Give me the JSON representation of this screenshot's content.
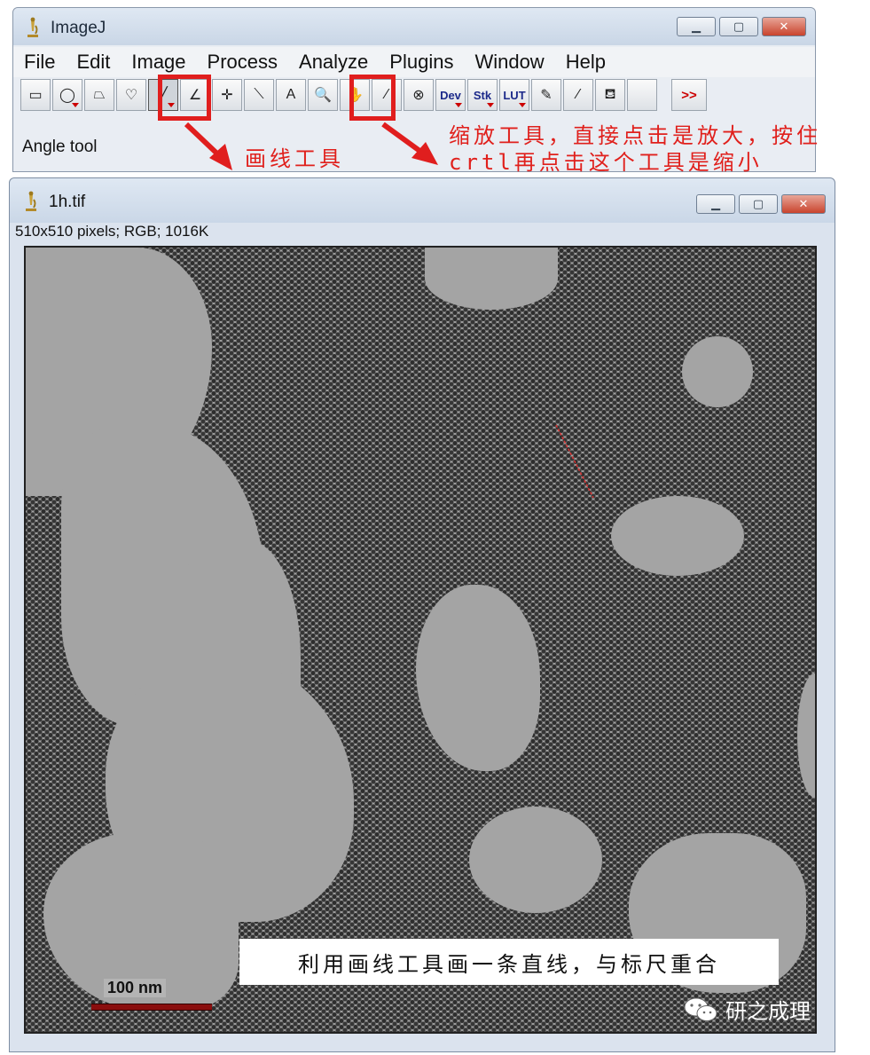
{
  "main_window": {
    "title": "ImageJ",
    "menu": [
      "File",
      "Edit",
      "Image",
      "Process",
      "Analyze",
      "Plugins",
      "Window",
      "Help"
    ],
    "tools": [
      {
        "name": "rectangle-tool",
        "icon": "rectangle-icon",
        "glyph": "▭",
        "selected": false
      },
      {
        "name": "oval-tool",
        "icon": "oval-icon",
        "glyph": "◯",
        "selected": false
      },
      {
        "name": "polygon-tool",
        "icon": "polygon-icon",
        "glyph": "⏢",
        "selected": false
      },
      {
        "name": "freehand-tool",
        "icon": "freehand-icon",
        "glyph": "♡",
        "selected": false
      },
      {
        "name": "line-tool",
        "icon": "line-icon",
        "glyph": "╱",
        "selected": true
      },
      {
        "name": "angle-tool",
        "icon": "angle-icon",
        "glyph": "∠",
        "selected": false
      },
      {
        "name": "point-tool",
        "icon": "point-icon",
        "glyph": "✛",
        "selected": false
      },
      {
        "name": "wand-tool",
        "icon": "wand-icon",
        "glyph": "⟍",
        "selected": false
      },
      {
        "name": "text-tool",
        "icon": "text-icon",
        "glyph": "A",
        "selected": false
      },
      {
        "name": "magnifier-tool",
        "icon": "magnifier-icon",
        "glyph": "🔍",
        "selected": false
      },
      {
        "name": "hand-tool",
        "icon": "hand-icon",
        "glyph": "✋",
        "selected": false
      },
      {
        "name": "dropper-tool",
        "icon": "dropper-icon",
        "glyph": "⁄",
        "selected": false
      },
      {
        "name": "stop-tool",
        "icon": "stop-icon",
        "glyph": "⊗",
        "selected": false
      },
      {
        "name": "dev-tool",
        "icon": "dev-icon",
        "glyph": "Dev",
        "selected": false
      },
      {
        "name": "stk-tool",
        "icon": "stk-icon",
        "glyph": "Stk",
        "selected": false
      },
      {
        "name": "lut-tool",
        "icon": "lut-icon",
        "glyph": "LUT",
        "selected": false
      },
      {
        "name": "pencil-tool",
        "icon": "pencil-icon",
        "glyph": "✎",
        "selected": false
      },
      {
        "name": "brush-tool",
        "icon": "brush-icon",
        "glyph": "⁄",
        "selected": false
      },
      {
        "name": "floodfill-tool",
        "icon": "floodfill-icon",
        "glyph": "⛾",
        "selected": false
      },
      {
        "name": "blank-tool",
        "icon": "blank-icon",
        "glyph": "",
        "selected": false
      },
      {
        "name": "more-tools",
        "icon": "more-icon",
        "glyph": ">>",
        "selected": false
      }
    ],
    "status": "Angle tool"
  },
  "annotations": {
    "line_tool_note": "画线工具",
    "zoom_note_line1": "缩放工具，直接点击是放大，按住",
    "zoom_note_line2": "crtl再点击这个工具是缩小",
    "bottom_note": "利用画线工具画一条直线，与标尺重合",
    "color": "#e0201c"
  },
  "image_window": {
    "title": "1h.tif",
    "info": "510x510 pixels; RGB; 1016K",
    "scale_bar_label": "100 nm",
    "scale_bar_color": "#8a0e0e"
  },
  "watermark": "研之成理"
}
